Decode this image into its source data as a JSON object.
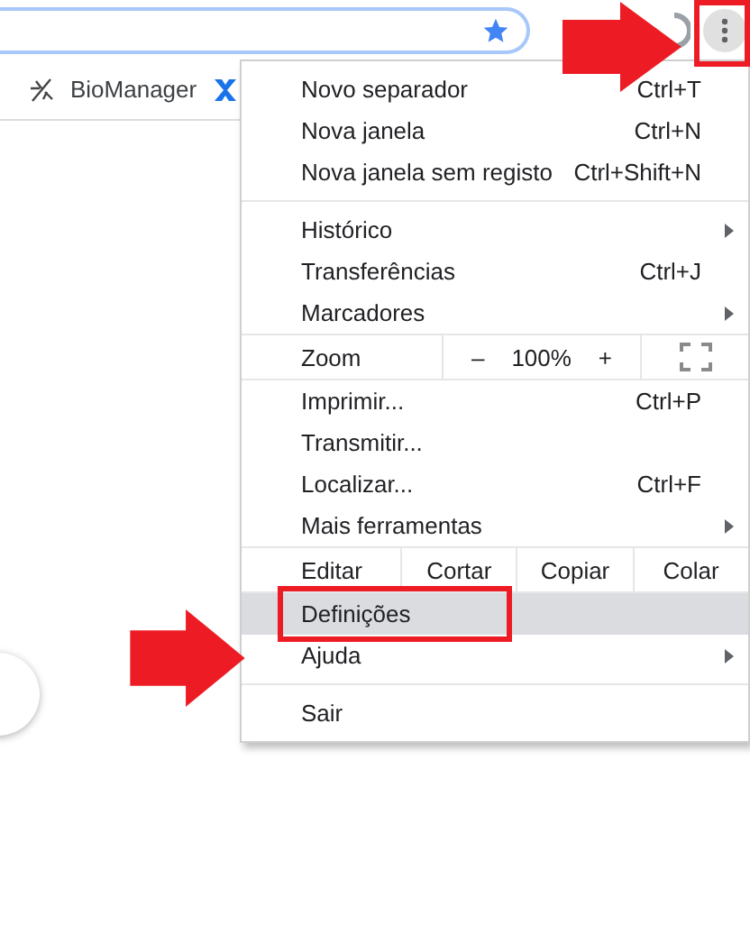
{
  "toolbar": {
    "address_bar": {
      "starred": true
    },
    "menu_button": {
      "annotated": true
    }
  },
  "bookmarks": [
    {
      "label": "BioManager"
    }
  ],
  "menu": {
    "sections": [
      [
        {
          "kind": "item",
          "label": "Novo separador",
          "shortcut": "Ctrl+T",
          "submenu": false,
          "selected": false,
          "annotated": false
        },
        {
          "kind": "item",
          "label": "Nova janela",
          "shortcut": "Ctrl+N",
          "submenu": false,
          "selected": false,
          "annotated": false
        },
        {
          "kind": "item",
          "label": "Nova janela sem registo",
          "shortcut": "Ctrl+Shift+N",
          "submenu": false,
          "selected": false,
          "annotated": false
        }
      ],
      [
        {
          "kind": "item",
          "label": "Histórico",
          "submenu": true,
          "selected": false,
          "annotated": false
        },
        {
          "kind": "item",
          "label": "Transferências",
          "shortcut": "Ctrl+J",
          "submenu": false,
          "selected": false,
          "annotated": false
        },
        {
          "kind": "item",
          "label": "Marcadores",
          "submenu": true,
          "selected": false,
          "annotated": false
        }
      ],
      [
        {
          "kind": "zoom",
          "label": "Zoom",
          "minus": "–",
          "value": "100%",
          "plus": "+"
        }
      ],
      [
        {
          "kind": "item",
          "label": "Imprimir...",
          "shortcut": "Ctrl+P",
          "submenu": false,
          "selected": false,
          "annotated": false
        },
        {
          "kind": "item",
          "label": "Transmitir...",
          "submenu": false,
          "selected": false,
          "annotated": false
        },
        {
          "kind": "item",
          "label": "Localizar...",
          "shortcut": "Ctrl+F",
          "submenu": false,
          "selected": false,
          "annotated": false
        },
        {
          "kind": "item",
          "label": "Mais ferramentas",
          "submenu": true,
          "selected": false,
          "annotated": false
        }
      ],
      [
        {
          "kind": "edit",
          "label": "Editar",
          "buttons": [
            "Cortar",
            "Copiar",
            "Colar"
          ]
        }
      ],
      [
        {
          "kind": "item",
          "label": "Definições",
          "submenu": false,
          "selected": true,
          "annotated": true
        },
        {
          "kind": "item",
          "label": "Ajuda",
          "submenu": true,
          "selected": false,
          "annotated": false
        }
      ],
      [
        {
          "kind": "item",
          "label": "Sair",
          "submenu": false,
          "selected": false,
          "annotated": false
        }
      ]
    ]
  }
}
